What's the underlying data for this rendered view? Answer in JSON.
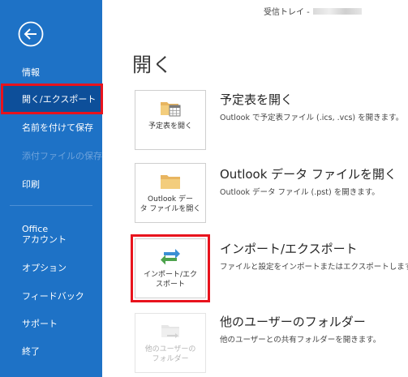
{
  "window": {
    "title_prefix": "受信トレイ -"
  },
  "colors": {
    "sidebar": "#1e72c6",
    "highlight": "#e8131d"
  },
  "sidebar": {
    "back_icon": "back-arrow-icon",
    "items": [
      {
        "label": "情報"
      },
      {
        "label": "開く/エクスポート"
      },
      {
        "label": "名前を付けて保存"
      },
      {
        "label": "添付ファイルの保存"
      },
      {
        "label": "印刷"
      },
      {
        "label_line1": "Office",
        "label_line2": "アカウント"
      },
      {
        "label": "オプション"
      },
      {
        "label": "フィードバック"
      },
      {
        "label": "サポート"
      },
      {
        "label": "終了"
      }
    ]
  },
  "main": {
    "title": "開く",
    "options": [
      {
        "tile_line1": "予定表を開く",
        "tile_line2": "",
        "title": "予定表を開く",
        "desc": "Outlook で予定表ファイル (.ics, .vcs) を開きます。"
      },
      {
        "tile_line1": "Outlook デー",
        "tile_line2": "タ ファイルを開く",
        "title": "Outlook データ ファイルを開く",
        "desc": "Outlook データ ファイル (.pst) を開きます。"
      },
      {
        "tile_line1": "インポート/エク",
        "tile_line2": "スポート",
        "title": "インポート/エクスポート",
        "desc": "ファイルと設定をインポートまたはエクスポートします。"
      },
      {
        "tile_line1": "他のユーザーの",
        "tile_line2": "フォルダー",
        "title": "他のユーザーのフォルダー",
        "desc": "他のユーザーとの共有フォルダーを開きます。"
      }
    ]
  }
}
